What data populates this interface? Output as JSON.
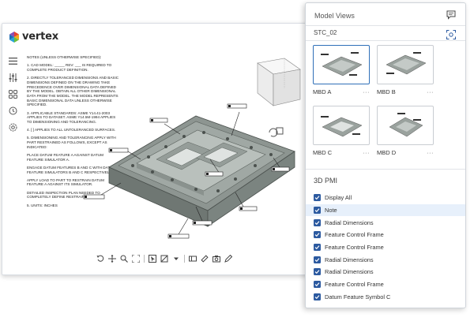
{
  "app": {
    "logo_text": "vertex",
    "brand_colors": [
      "#e8422f",
      "#f2a91c",
      "#2aa4d8",
      "#6cbf3c"
    ]
  },
  "left_toolbar": {
    "icons": [
      "menu-icon",
      "sliders-icon",
      "grid-icon",
      "history-icon",
      "settings-icon"
    ]
  },
  "notes": {
    "title": "NOTES (UNLESS OTHERWISE SPECIFIED):",
    "items": [
      "1. CAD MODEL: _____ REV: ___ IS REQUIRED TO COMPLETE PRODUCT DEFINITION.",
      "2. DIRECTLY TOLERANCED DIMENSIONS AND BASIC DIMENSIONS DEFINED ON THE DRAWING TAKE PRECEDENCE OVER DIMENSIONAL DATA DEFINED BY THE MODEL. OBTAIN ALL OTHER DIMENSIONAL DATA FROM THE MODEL. THE MODEL REPRESENTS BASIC DIMENSIONAL DATA UNLESS OTHERWISE SPECIFIED.",
      "3. APPLICABLE STANDARDS: ASME Y14.41-2003 APPLIES TO DATASET. ASME Y14.5M-1994 APPLIES TO DIMENSIONING AND TOLERANCING.",
      "4. [ ] APPLIES TO ALL UNTOLERANCED SURFACES.",
      "5. DIMENSIONING AND TOLERANCING APPLY WITH PART RESTRAINED AS FOLLOWS, EXCEPT AS INDICATED:",
      "PLACE DATUM FEATURE A AGAINST DATUM FEATURE SIMULATOR A.",
      "ENGAGE DATUM FEATURES B AND C WITH DATUM FEATURE SIMULATORS B AND C RESPECTIVELY.",
      "APPLY LOAD TO PART TO RESTRAIN DATUM FEATURE A AGAINST ITS SIMULATOR.",
      "DETAILED INSPECTION PLAN NEEDED TO COMPLETELY DEFINE RESTRAINT.",
      "5. UNITS: INCHES"
    ]
  },
  "bottom_toolbar": {
    "icons": [
      "rotate-icon",
      "pan-icon",
      "zoom-icon",
      "fit-icon",
      "select-icon",
      "section-icon",
      "measure-icon",
      "pmi-icon",
      "camera-icon",
      "markup-icon"
    ]
  },
  "panel": {
    "header": "Model Views",
    "model_name": "STC_02",
    "views": [
      {
        "label": "MBD A",
        "more": "···",
        "selected": true
      },
      {
        "label": "MBD B",
        "more": "···",
        "selected": false
      },
      {
        "label": "MBD C",
        "more": "···",
        "selected": false
      },
      {
        "label": "MBD D",
        "more": "···",
        "selected": false
      }
    ],
    "pmi_title": "3D PMI",
    "pmi_items": [
      {
        "label": "Display All",
        "checked": true,
        "selected": false
      },
      {
        "label": "Note",
        "checked": true,
        "selected": true
      },
      {
        "label": "Radial Dimensions",
        "checked": true,
        "selected": false
      },
      {
        "label": "Feature Control Frame",
        "checked": true,
        "selected": false
      },
      {
        "label": "Feature Control Frame",
        "checked": true,
        "selected": false
      },
      {
        "label": "Radial Dimensions",
        "checked": true,
        "selected": false
      },
      {
        "label": "Radial Dimensions",
        "checked": true,
        "selected": false
      },
      {
        "label": "Feature Control Frame",
        "checked": true,
        "selected": false
      },
      {
        "label": "Datum Feature Symbol C",
        "checked": true,
        "selected": false
      }
    ],
    "accent_color": "#2c5aa0"
  },
  "side_icons": [
    "comment-icon",
    "fit-view-icon"
  ]
}
